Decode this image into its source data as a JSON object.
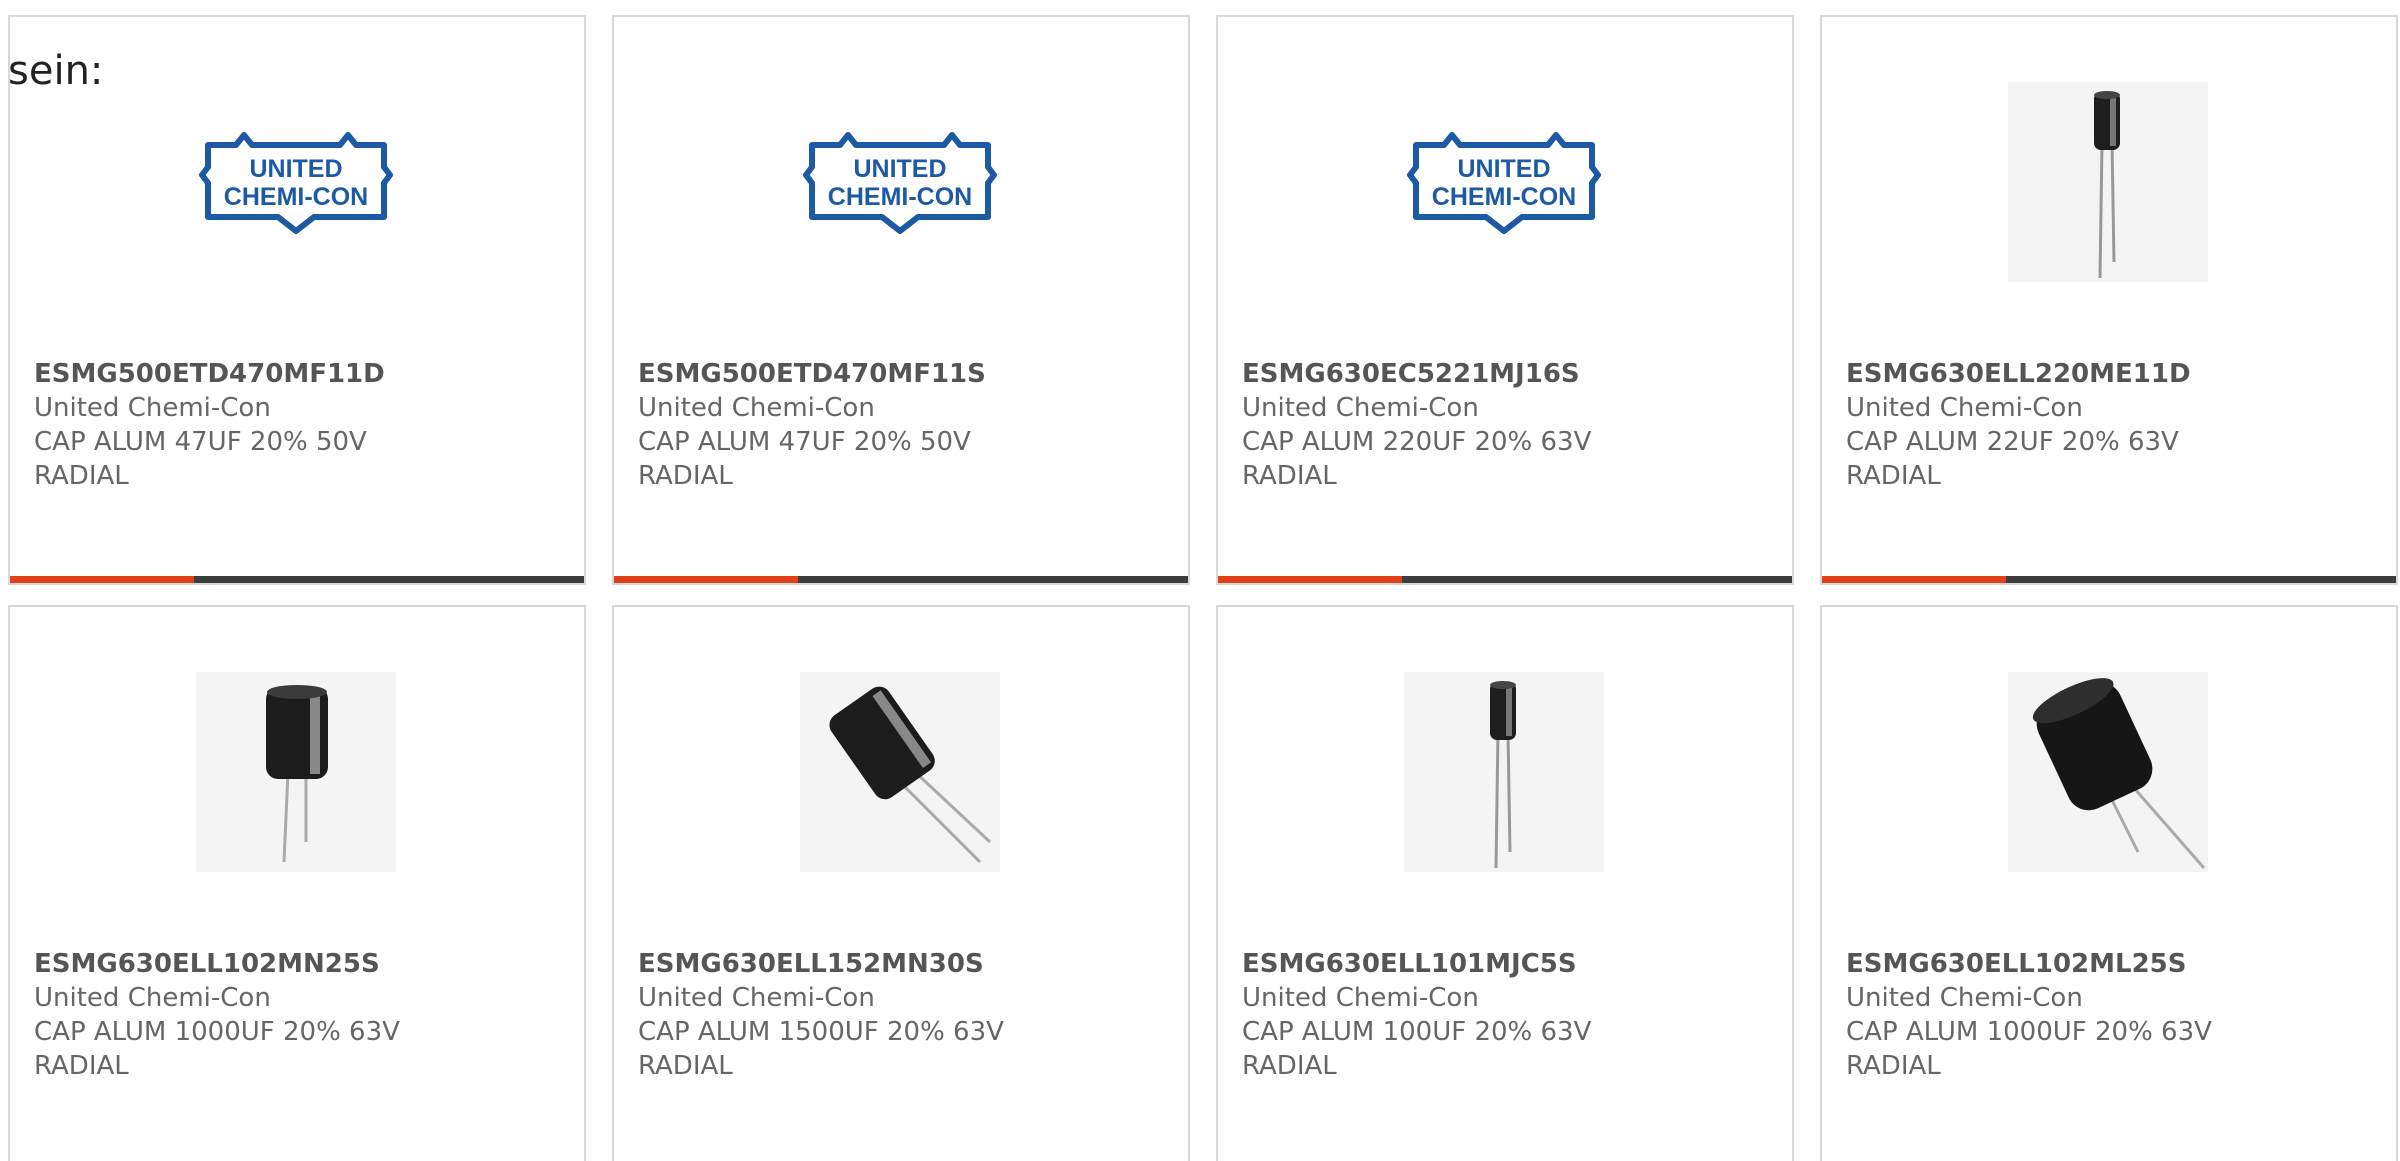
{
  "intro_text": "sein:",
  "colors": {
    "accent": "#e0401a",
    "track": "#3d3d3d",
    "card_border": "#d8d8d8",
    "logo_blue": "#1c5aa6"
  },
  "products": [
    {
      "part_number": "ESMG500ETD470MF11D",
      "manufacturer": "United Chemi-Con",
      "desc_line1": "CAP ALUM 47UF 20% 50V",
      "desc_line2": "RADIAL",
      "image": "united-chemi-con-logo",
      "logo_text1": "UNITED",
      "logo_text2": "CHEMI-CON",
      "progress": 0.32
    },
    {
      "part_number": "ESMG500ETD470MF11S",
      "manufacturer": "United Chemi-Con",
      "desc_line1": "CAP ALUM 47UF 20% 50V",
      "desc_line2": "RADIAL",
      "image": "united-chemi-con-logo",
      "logo_text1": "UNITED",
      "logo_text2": "CHEMI-CON",
      "progress": 0.32
    },
    {
      "part_number": "ESMG630EC5221MJ16S",
      "manufacturer": "United Chemi-Con",
      "desc_line1": "CAP ALUM 220UF 20% 63V",
      "desc_line2": "RADIAL",
      "image": "united-chemi-con-logo",
      "logo_text1": "UNITED",
      "logo_text2": "CHEMI-CON",
      "progress": 0.32
    },
    {
      "part_number": "ESMG630ELL220ME11D",
      "manufacturer": "United Chemi-Con",
      "desc_line1": "CAP ALUM 22UF 20% 63V",
      "desc_line2": "RADIAL",
      "image": "capacitor-small-long-leads",
      "progress": 0.32
    },
    {
      "part_number": "ESMG630ELL102MN25S",
      "manufacturer": "United Chemi-Con",
      "desc_line1": "CAP ALUM 1000UF 20% 63V",
      "desc_line2": "RADIAL",
      "image": "capacitor-upright",
      "progress": 0
    },
    {
      "part_number": "ESMG630ELL152MN30S",
      "manufacturer": "United Chemi-Con",
      "desc_line1": "CAP ALUM 1500UF 20% 63V",
      "desc_line2": "RADIAL",
      "image": "capacitor-tilted",
      "progress": 0
    },
    {
      "part_number": "ESMG630ELL101MJC5S",
      "manufacturer": "United Chemi-Con",
      "desc_line1": "CAP ALUM 100UF 20% 63V",
      "desc_line2": "RADIAL",
      "image": "capacitor-small-long-leads",
      "progress": 0
    },
    {
      "part_number": "ESMG630ELL102ML25S",
      "manufacturer": "United Chemi-Con",
      "desc_line1": "CAP ALUM 1000UF 20% 63V",
      "desc_line2": "RADIAL",
      "image": "capacitor-large-tilted",
      "progress": 0
    }
  ]
}
